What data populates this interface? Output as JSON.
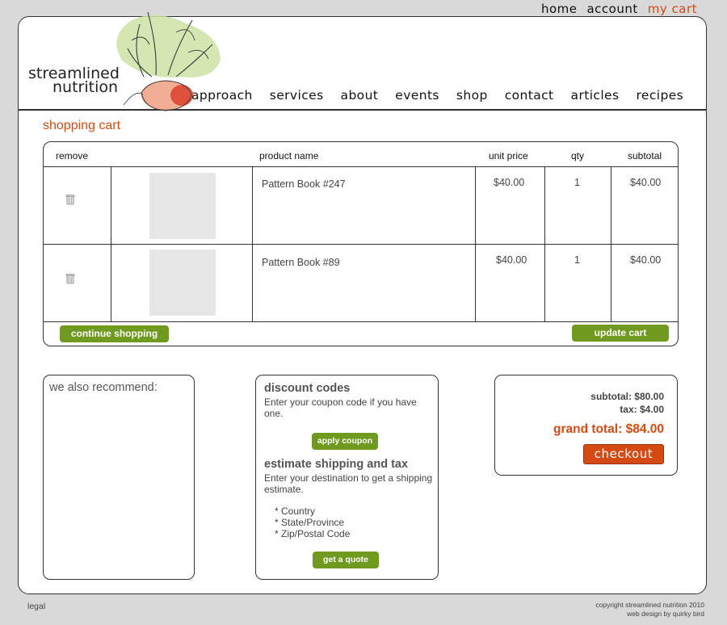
{
  "top_nav": {
    "home": "home",
    "account": "account",
    "my_cart": "my cart"
  },
  "logo": {
    "line1": "streamlined",
    "line2": "nutrition"
  },
  "main_nav": [
    "approach",
    "services",
    "about",
    "events",
    "shop",
    "contact",
    "articles",
    "recipes"
  ],
  "page_title": "shopping cart",
  "cart": {
    "headers": {
      "remove": "remove",
      "product": "product name",
      "unit_price": "unit price",
      "qty": "qty",
      "subtotal": "subtotal"
    },
    "rows": [
      {
        "name": "Pattern Book #247",
        "unit_price": "$40.00",
        "qty": "1",
        "subtotal": "$40.00"
      },
      {
        "name": "Pattern Book #89",
        "unit_price": "$40.00",
        "qty": "1",
        "subtotal": "$40.00"
      }
    ],
    "continue_label": "continue shopping",
    "update_label": "update cart"
  },
  "recommend": {
    "title": "we also recommend:"
  },
  "discount": {
    "title": "discount codes",
    "text": "Enter your coupon code if you have one.",
    "apply_label": "apply coupon",
    "ship_title": "estimate shipping and tax",
    "ship_text": "Enter your destination to get a shipping estimate.",
    "fields": [
      "* Country",
      "* State/Province",
      "* Zip/Postal Code"
    ],
    "quote_label": "get a quote"
  },
  "totals": {
    "subtotal": "subtotal: $80.00",
    "tax": "tax: $4.00",
    "grand_total": "grand total: $84.00",
    "checkout_label": "checkout"
  },
  "footer": {
    "legal": "legal",
    "copyright": "copyright streamlined nutrition 2010",
    "credit": "web design by quirky bird"
  },
  "colors": {
    "accent": "#d44a12",
    "button_green": "#6f9a1f",
    "page_bg": "#d9d9d9"
  },
  "icons": {
    "remove": "trash-can-icon"
  }
}
